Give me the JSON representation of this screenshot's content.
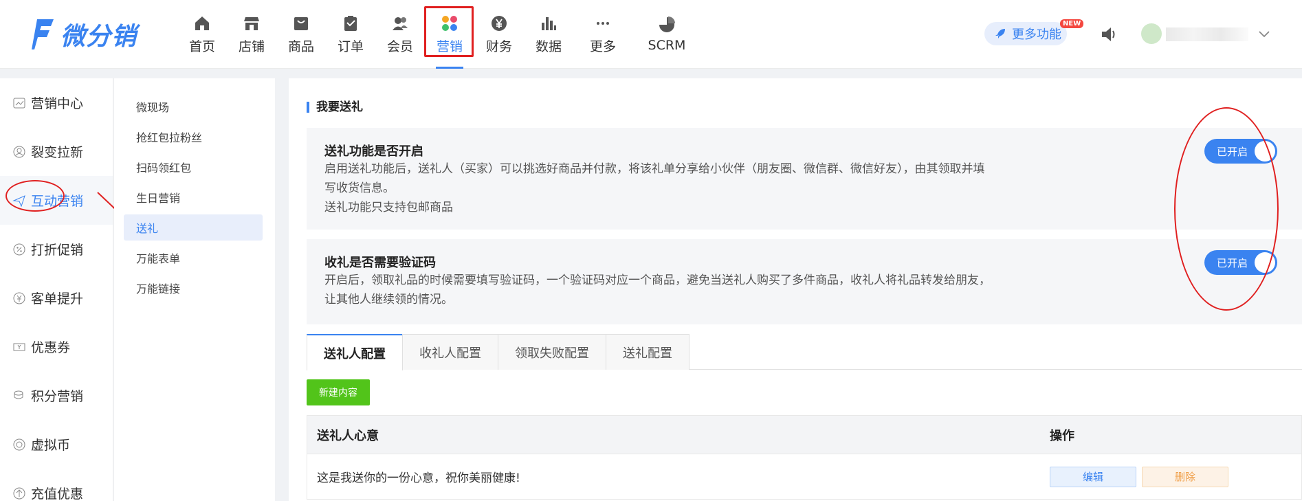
{
  "app": {
    "logo_text": "微分销",
    "brand_color": "#3a83f0"
  },
  "nav": {
    "items": [
      {
        "label": "首页",
        "icon": "home-icon"
      },
      {
        "label": "店铺",
        "icon": "store-icon"
      },
      {
        "label": "商品",
        "icon": "goods-box-icon"
      },
      {
        "label": "订单",
        "icon": "clipboard-icon"
      },
      {
        "label": "会员",
        "icon": "members-icon"
      },
      {
        "label": "营销",
        "icon": "marketing-grid-icon",
        "active": true
      },
      {
        "label": "财务",
        "icon": "yen-coin-icon"
      },
      {
        "label": "数据",
        "icon": "bar-chart-icon"
      },
      {
        "label": "更多",
        "icon": "more-dots-icon"
      },
      {
        "label": "SCRM",
        "icon": "pie-chart-icon"
      }
    ]
  },
  "header": {
    "more_features": "更多功能",
    "new_badge": "NEW"
  },
  "sidebar": {
    "items": [
      {
        "label": "营销中心",
        "icon": "trend-chart-icon"
      },
      {
        "label": "裂变拉新",
        "icon": "user-refresh-icon"
      },
      {
        "label": "互动营销",
        "icon": "paper-plane-icon",
        "active": true
      },
      {
        "label": "打折促销",
        "icon": "discount-badge-icon"
      },
      {
        "label": "客单提升",
        "icon": "yen-circle-icon"
      },
      {
        "label": "优惠券",
        "icon": "coupon-icon"
      },
      {
        "label": "积分营销",
        "icon": "coins-stack-icon"
      },
      {
        "label": "虚拟币",
        "icon": "virtual-coin-icon"
      },
      {
        "label": "充值优惠",
        "icon": "recharge-icon"
      }
    ]
  },
  "subnav": {
    "items": [
      {
        "label": "微现场"
      },
      {
        "label": "抢红包拉粉丝"
      },
      {
        "label": "扫码领红包"
      },
      {
        "label": "生日营销"
      },
      {
        "label": "送礼",
        "active": true
      },
      {
        "label": "万能表单"
      },
      {
        "label": "万能链接"
      }
    ]
  },
  "main": {
    "section_title": "我要送礼",
    "settings": [
      {
        "title": "送礼功能是否开启",
        "desc": [
          "启用送礼功能后，送礼人（买家）可以挑选好商品并付款，将该礼单分享给小伙伴（朋友圈、微信群、微信好友），由其领取并填",
          "写收货信息。",
          "送礼功能只支持包邮商品"
        ],
        "toggle_label": "已开启",
        "enabled": true
      },
      {
        "title": "收礼是否需要验证码",
        "desc": [
          "开启后，领取礼品的时候需要填写验证码，一个验证码对应一个商品，避免当送礼人购买了多件商品，收礼人将礼品转发给朋友，",
          "让其他人继续领的情况。"
        ],
        "toggle_label": "已开启",
        "enabled": true
      }
    ],
    "tabs": [
      {
        "label": "送礼人配置",
        "active": true
      },
      {
        "label": "收礼人配置"
      },
      {
        "label": "领取失败配置"
      },
      {
        "label": "送礼配置"
      }
    ],
    "new_button": "新建内容",
    "table": {
      "columns": [
        "送礼人心意",
        "操作"
      ],
      "rows": [
        {
          "message": "这是我送你的一份心意，祝你美丽健康!",
          "edit": "编辑",
          "delete": "删除"
        }
      ]
    }
  },
  "colors": {
    "accent": "#3a83f0",
    "green_button": "#52c41a",
    "highlight_red": "#e02020"
  }
}
